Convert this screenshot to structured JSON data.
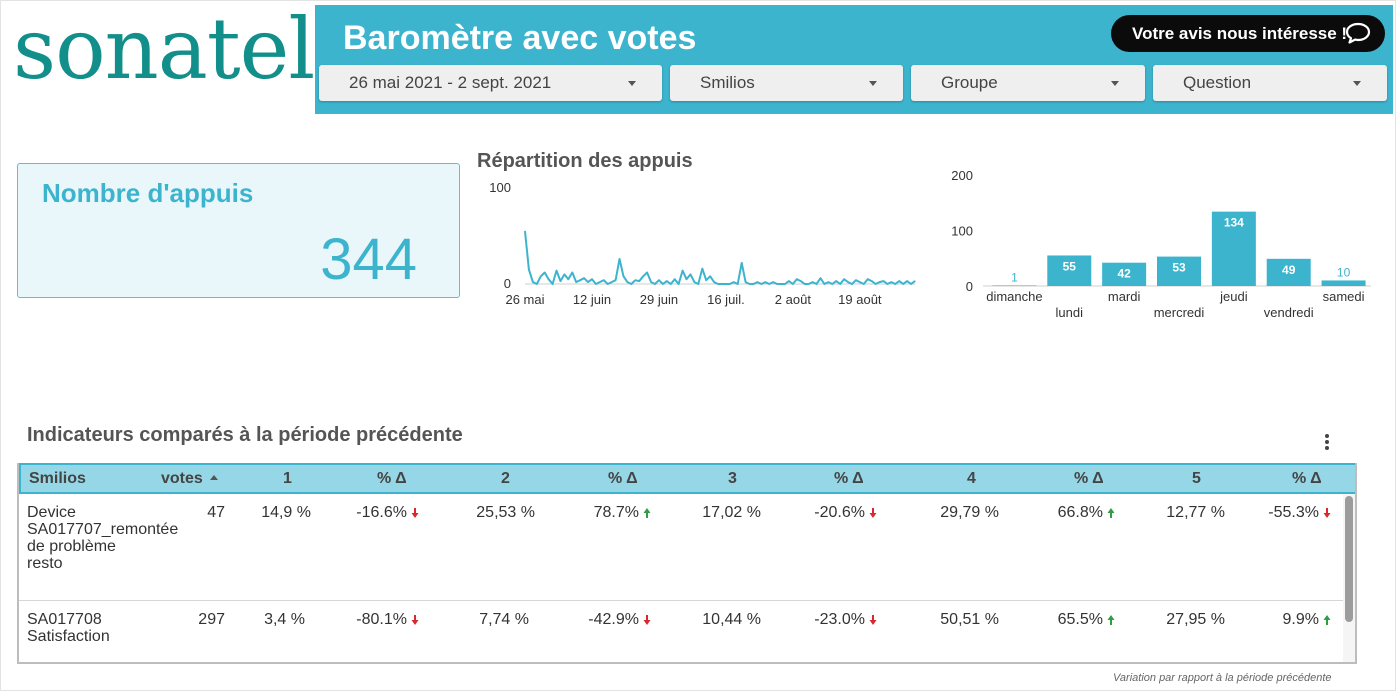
{
  "logo": {
    "text": "sonatel"
  },
  "header": {
    "title": "Baromètre avec votes",
    "feedback_button": "Votre avis nous intéresse !",
    "filters": [
      "26 mai 2021 - 2 sept. 2021",
      "Smilios",
      "Groupe",
      "Question"
    ]
  },
  "scorecard": {
    "title": "Nombre d'appuis",
    "value": "344"
  },
  "repartition": {
    "title": "Répartition des appuis"
  },
  "table_section": {
    "title": "Indicateurs comparés à la période précédente",
    "headers": [
      "Smilios",
      "votes",
      "1",
      "% Δ",
      "2",
      "% Δ",
      "3",
      "% Δ",
      "4",
      "% Δ",
      "5",
      "% Δ"
    ],
    "rows": [
      {
        "name": "Device SA017707_remontée de problème resto",
        "votes": "47",
        "cells": [
          "14,9 %",
          "-16.6%",
          "25,53 %",
          "78.7%",
          "17,02 %",
          "-20.6%",
          "29,79 %",
          "66.8%",
          "12,77 %",
          "-55.3%"
        ],
        "trends": [
          "",
          "down",
          "",
          "up",
          "",
          "down",
          "",
          "up",
          "",
          "down"
        ]
      },
      {
        "name": "SA017708 Satisfaction",
        "votes": "297",
        "cells": [
          "3,4 %",
          "-80.1%",
          "7,74 %",
          "-42.9%",
          "10,44 %",
          "-23.0%",
          "50,51 %",
          "65.5%",
          "27,95 %",
          "9.9%"
        ],
        "trends": [
          "",
          "down",
          "",
          "down",
          "",
          "down",
          "",
          "up",
          "",
          "up"
        ]
      }
    ],
    "footnote": "Variation par rapport à la période précédente"
  },
  "colors": {
    "accent": "#3cb4ce",
    "logo": "#128f8b",
    "up": "#2e9e44",
    "down": "#d9282f"
  },
  "chart_data": [
    {
      "type": "line",
      "title": "Répartition des appuis",
      "x_ticks": [
        "26 mai",
        "12 juin",
        "29 juin",
        "16 juil.",
        "2 août",
        "19 août"
      ],
      "y_ticks": [
        "0",
        "100"
      ],
      "ylim": [
        0,
        100
      ],
      "x": [
        "2021-05-26",
        "2021-05-27",
        "2021-05-28",
        "2021-05-29",
        "2021-05-30",
        "2021-05-31",
        "2021-06-01",
        "2021-06-02",
        "2021-06-03",
        "2021-06-04",
        "2021-06-05",
        "2021-06-06",
        "2021-06-07",
        "2021-06-08",
        "2021-06-09",
        "2021-06-10",
        "2021-06-11",
        "2021-06-12",
        "2021-06-13",
        "2021-06-14",
        "2021-06-15",
        "2021-06-16",
        "2021-06-17",
        "2021-06-18",
        "2021-06-19",
        "2021-06-20",
        "2021-06-21",
        "2021-06-22",
        "2021-06-23",
        "2021-06-24",
        "2021-06-25",
        "2021-06-26",
        "2021-06-27",
        "2021-06-28",
        "2021-06-29",
        "2021-06-30",
        "2021-07-01",
        "2021-07-02",
        "2021-07-03",
        "2021-07-04",
        "2021-07-05",
        "2021-07-06",
        "2021-07-07",
        "2021-07-08",
        "2021-07-09",
        "2021-07-10",
        "2021-07-11",
        "2021-07-12",
        "2021-07-13",
        "2021-07-14",
        "2021-07-15",
        "2021-07-16",
        "2021-07-17",
        "2021-07-18",
        "2021-07-19",
        "2021-07-20",
        "2021-07-21",
        "2021-07-22",
        "2021-07-23",
        "2021-07-24",
        "2021-07-25",
        "2021-07-26",
        "2021-07-27",
        "2021-07-28",
        "2021-07-29",
        "2021-07-30",
        "2021-07-31",
        "2021-08-01",
        "2021-08-02",
        "2021-08-03",
        "2021-08-04",
        "2021-08-05",
        "2021-08-06",
        "2021-08-07",
        "2021-08-08",
        "2021-08-09",
        "2021-08-10",
        "2021-08-11",
        "2021-08-12",
        "2021-08-13",
        "2021-08-14",
        "2021-08-15",
        "2021-08-16",
        "2021-08-17",
        "2021-08-18",
        "2021-08-19",
        "2021-08-20",
        "2021-08-21",
        "2021-08-22",
        "2021-08-23",
        "2021-08-24",
        "2021-08-25",
        "2021-08-26",
        "2021-08-27",
        "2021-08-28",
        "2021-08-29",
        "2021-08-30",
        "2021-08-31",
        "2021-09-01",
        "2021-09-02"
      ],
      "y": [
        55,
        15,
        2,
        0,
        8,
        12,
        5,
        0,
        14,
        3,
        10,
        5,
        12,
        2,
        4,
        6,
        2,
        5,
        0,
        2,
        4,
        0,
        2,
        4,
        26,
        8,
        2,
        0,
        4,
        3,
        8,
        12,
        2,
        0,
        4,
        0,
        3,
        0,
        5,
        0,
        14,
        5,
        10,
        2,
        0,
        16,
        4,
        8,
        2,
        0,
        0,
        0,
        0,
        2,
        0,
        22,
        2,
        0,
        0,
        2,
        0,
        2,
        0,
        2,
        0,
        0,
        0,
        3,
        0,
        5,
        3,
        0,
        0,
        2,
        0,
        6,
        0,
        2,
        0,
        3,
        0,
        5,
        2,
        0,
        4,
        2,
        0,
        5,
        3,
        0,
        2,
        3,
        0,
        2,
        0,
        3,
        0,
        3,
        0,
        3
      ]
    },
    {
      "type": "bar",
      "categories": [
        "dimanche",
        "lundi",
        "mardi",
        "mercredi",
        "jeudi",
        "vendredi",
        "samedi"
      ],
      "values": [
        1,
        55,
        42,
        53,
        134,
        49,
        10
      ],
      "y_ticks": [
        "0",
        "100",
        "200"
      ],
      "ylim": [
        0,
        200
      ]
    }
  ]
}
